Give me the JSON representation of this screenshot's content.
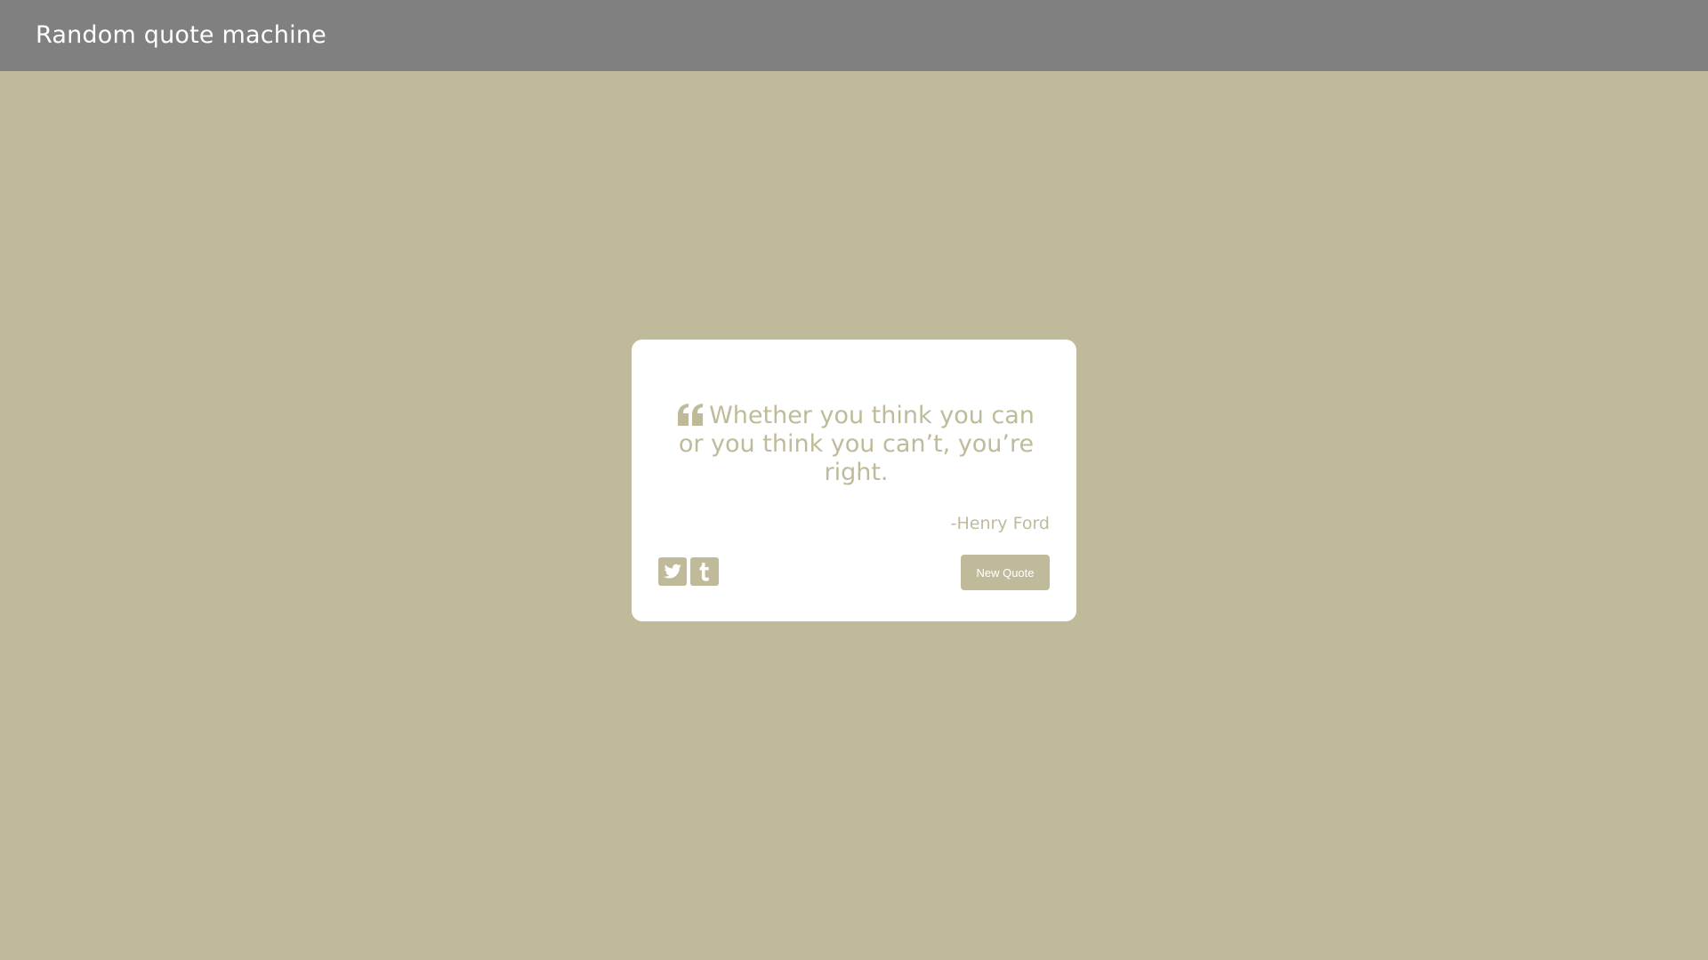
{
  "header": {
    "title": "Random quote machine"
  },
  "quote": {
    "text": "Whether you think you can or you think you can’t, you’re right.",
    "author": "-Henry Ford",
    "icon": "quote-left-icon"
  },
  "actions": {
    "twitter_icon": "twitter-icon",
    "tumblr_icon": "tumblr-icon",
    "new_quote_label": "New Quote"
  },
  "colors": {
    "background": "#bfbb9a",
    "header": "#808080",
    "card": "#ffffff",
    "accent": "#bfbb9a",
    "button_text": "#ffffff"
  }
}
